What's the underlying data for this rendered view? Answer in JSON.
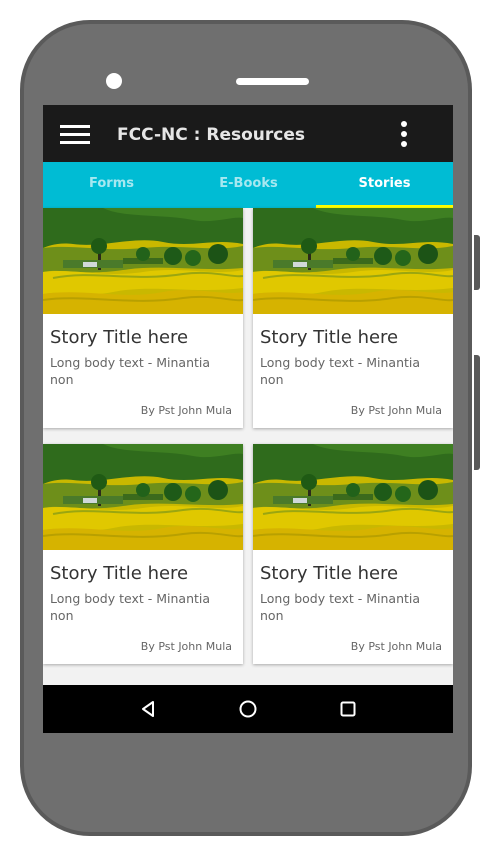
{
  "app": {
    "title": "FCC-NC : Resources",
    "menu_icon": "hamburger-menu-icon",
    "overflow_icon": "more-vert-icon"
  },
  "tabs": [
    {
      "label": "Forms",
      "selected": false
    },
    {
      "label": "E-Books",
      "selected": false
    },
    {
      "label": "Stories",
      "selected": true
    }
  ],
  "stories": [
    {
      "title": "Story Title here",
      "body": "Long body text - Minantia non",
      "author": "By Pst John Mula",
      "image": "rice-terrace-landscape"
    },
    {
      "title": "Story Title here",
      "body": "Long body text - Minantia non",
      "author": "By Pst John Mula",
      "image": "rice-terrace-landscape"
    },
    {
      "title": "Story Title here",
      "body": "Long body text - Minantia non",
      "author": "By Pst John Mula",
      "image": "rice-terrace-landscape"
    },
    {
      "title": "Story Title here",
      "body": "Long body text - Minantia non",
      "author": "By Pst John Mula",
      "image": "rice-terrace-landscape"
    }
  ],
  "fab": {
    "label": "+",
    "icon": "add-icon"
  },
  "system_nav": {
    "back_icon": "back-triangle-icon",
    "home_icon": "home-circle-icon",
    "recents_icon": "recents-square-icon"
  },
  "colors": {
    "app_bar": "#1a1a1a",
    "tab_bar": "#00bcd4",
    "tab_indicator": "#ffff00",
    "fab": "#00bcd4",
    "phone_body": "#6f6f6f"
  }
}
